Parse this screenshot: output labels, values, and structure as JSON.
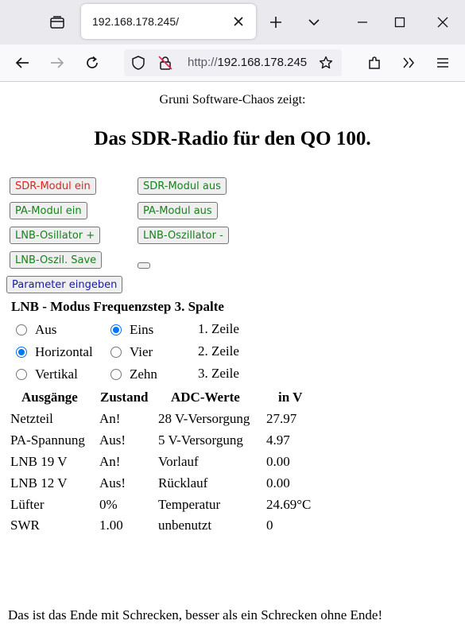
{
  "browser": {
    "tab_title": "192.168.178.245/",
    "url_prefix": "http://",
    "url_host": "192.168.178.245/"
  },
  "page": {
    "subtitle": "Gruni Software-Chaos zeigt:",
    "title": "Das SDR-Radio für den QO 100.",
    "buttons": {
      "sdr_on": "SDR-Modul ein",
      "sdr_off": "SDR-Modul aus",
      "pa_on": "PA-Modul ein",
      "pa_off": "PA-Modul aus",
      "lnb_plus": "LNB-Osillator +",
      "lnb_minus": "LNB-Oszillator -",
      "lnb_save": "LNB-Oszil. Save",
      "params": "Parameter eingeben"
    },
    "section_head": "LNB - Modus Frequenzstep 3. Spalte",
    "lnb_modus": [
      {
        "label": "Aus",
        "checked": false
      },
      {
        "label": "Horizontal",
        "checked": true
      },
      {
        "label": "Vertikal",
        "checked": false
      }
    ],
    "frequenzstep": [
      {
        "label": "Eins",
        "checked": true
      },
      {
        "label": "Vier",
        "checked": false
      },
      {
        "label": "Zehn",
        "checked": false
      }
    ],
    "spalte": [
      "1. Zeile",
      "2. Zeile",
      "3. Zeile"
    ],
    "table": {
      "headers": [
        "Ausgänge",
        "Zustand",
        "ADC-Werte",
        "in V"
      ],
      "rows": [
        [
          "Netzteil",
          "An!",
          "28 V-Versorgung",
          "27.97"
        ],
        [
          "PA-Spannung",
          "Aus!",
          "5 V-Versorgung",
          "4.97"
        ],
        [
          "LNB 19 V",
          "An!",
          "Vorlauf",
          "0.00"
        ],
        [
          "LNB 12 V",
          "Aus!",
          "Rücklauf",
          "0.00"
        ],
        [
          "Lüfter",
          "0%",
          "Temperatur",
          "24.69°C"
        ],
        [
          "SWR",
          "1.00",
          "unbenutzt",
          "0"
        ]
      ]
    },
    "footer": "Das ist das Ende mit Schrecken, besser als ein Schrecken ohne Ende!"
  },
  "colors": {
    "button_red": "#e2231a",
    "button_green": "#16821c",
    "button_blue": "#1a1aa8",
    "radio_accent": "#0075ff"
  }
}
